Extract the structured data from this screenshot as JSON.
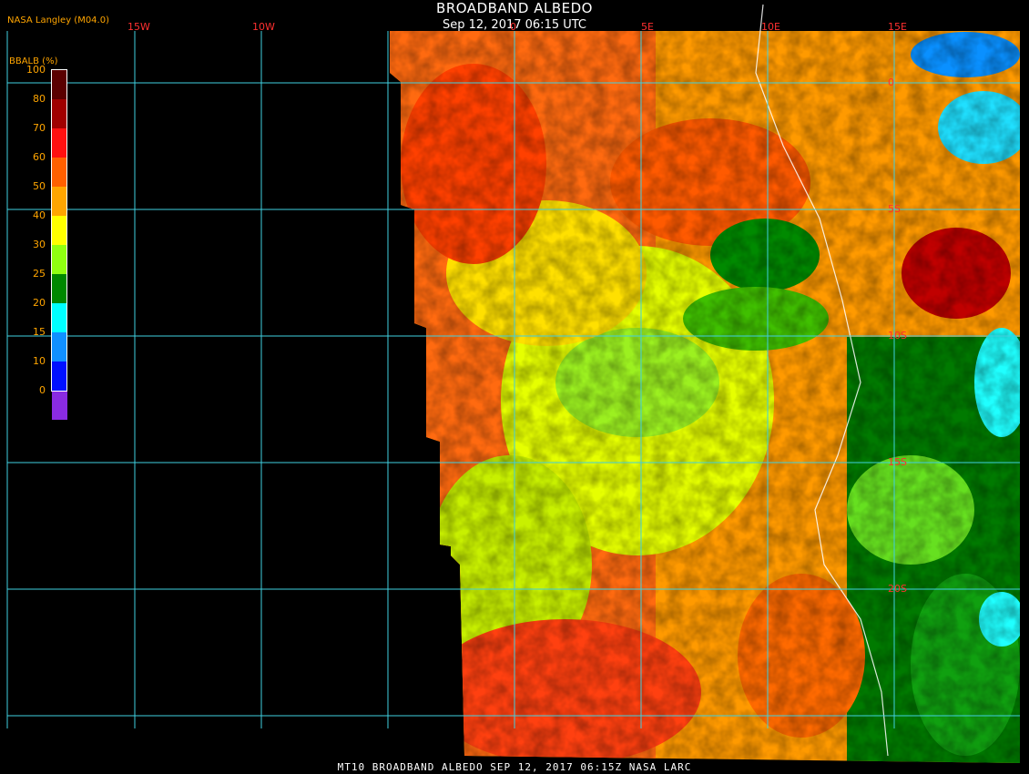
{
  "header": {
    "title": "BROADBAND ALBEDO",
    "subtitle": "Sep 12, 2017 06:15 UTC",
    "credit": "NASA Langley (M04.0)"
  },
  "footer": {
    "text": "MT10  BROADBAND ALBEDO  SEP 12, 2017 06:15Z  NASA LARC"
  },
  "colorbar": {
    "title": "BBALB (%)",
    "labels": [
      "100",
      "80",
      "70",
      "60",
      "50",
      "40",
      "30",
      "25",
      "20",
      "15",
      "10",
      "0"
    ],
    "colors": [
      "#5a0000",
      "#a00000",
      "#ff1010",
      "#ff6000",
      "#ffa500",
      "#ffff00",
      "#90ff10",
      "#008800",
      "#00ffff",
      "#1090ff",
      "#0010ff",
      "#8a2be2"
    ]
  },
  "grid": {
    "longitude_labels": [
      "15W",
      "10W",
      "0",
      "5E",
      "10E",
      "15E"
    ],
    "latitude_labels": [
      "0",
      "5S",
      "10S",
      "15S",
      "20S"
    ],
    "line_color": "#40d0e0"
  }
}
